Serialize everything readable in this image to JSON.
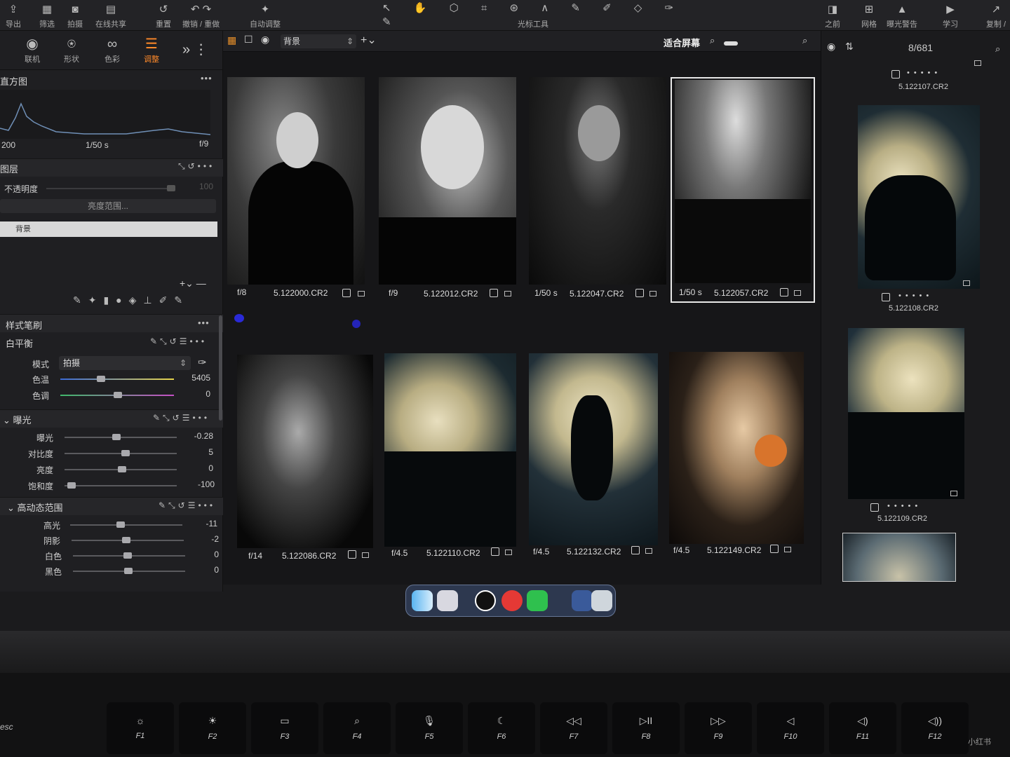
{
  "toolbar": {
    "left_items": [
      "导出",
      "筛选",
      "拍摄",
      "在线共享",
      "重置",
      "撤销 / 重做",
      "自动调整"
    ],
    "center_label": "光标工具",
    "right_items": [
      "之前",
      "网格",
      "曝光警告",
      "学习",
      "复制 / 应"
    ]
  },
  "tabs": [
    {
      "label": "联机",
      "icon": "camera-icon"
    },
    {
      "label": "形状",
      "icon": "shape-icon"
    },
    {
      "label": "色彩",
      "icon": "color-icon"
    },
    {
      "label": "调整",
      "icon": "adjust-icon",
      "active": true
    }
  ],
  "histogram": {
    "title": "直方图",
    "iso": "200",
    "shutter": "1/50 s",
    "aperture": "f/9"
  },
  "layers": {
    "title": "图层",
    "opacity_label": "不透明度",
    "opacity_value": "100",
    "range_button": "亮度范围...",
    "layer_name": "背景"
  },
  "style_brush": {
    "title": "样式笔刷"
  },
  "white_balance": {
    "title": "白平衡",
    "mode_label": "模式",
    "mode_value": "拍摄",
    "rows": [
      {
        "label": "色温",
        "value": "5405",
        "pos": 0.36
      },
      {
        "label": "色调",
        "value": "0",
        "pos": 0.5
      }
    ]
  },
  "exposure": {
    "title": "曝光",
    "rows": [
      {
        "label": "曝光",
        "value": "-0.28",
        "pos": 0.45
      },
      {
        "label": "对比度",
        "value": "5",
        "pos": 0.52
      },
      {
        "label": "亮度",
        "value": "0",
        "pos": 0.5
      },
      {
        "label": "饱和度",
        "value": "-100",
        "pos": 0.0
      }
    ]
  },
  "hdr": {
    "title": "高动态范围",
    "rows": [
      {
        "label": "高光",
        "value": "-11",
        "pos": 0.45
      },
      {
        "label": "阴影",
        "value": "-2",
        "pos": 0.49
      },
      {
        "label": "白色",
        "value": "0",
        "pos": 0.5
      },
      {
        "label": "黑色",
        "value": "0",
        "pos": 0.5
      }
    ]
  },
  "viewbar": {
    "layer_select": "背景",
    "fit_label": "适合屏幕",
    "counter": "8/681"
  },
  "grid": [
    {
      "exif": "f/8",
      "name": "5.122000.CR2"
    },
    {
      "exif": "f/9",
      "name": "5.122012.CR2"
    },
    {
      "exif": "1/50 s",
      "name": "5.122047.CR2"
    },
    {
      "exif": "1/50 s",
      "name": "5.122057.CR2",
      "selected": true
    },
    {
      "exif": "f/14",
      "name": "5.122086.CR2"
    },
    {
      "exif": "f/4.5",
      "name": "5.122110.CR2"
    },
    {
      "exif": "f/4.5",
      "name": "5.122132.CR2"
    },
    {
      "exif": "f/4.5",
      "name": "5.122149.CR2"
    }
  ],
  "strip": [
    {
      "name": "5.122107.CR2"
    },
    {
      "name": "5.122108.CR2"
    },
    {
      "name": "5.122109.CR2"
    }
  ],
  "fkeys": [
    {
      "glyph": "☼",
      "key": "F1"
    },
    {
      "glyph": "☀",
      "key": "F2"
    },
    {
      "glyph": "▭",
      "key": "F3"
    },
    {
      "glyph": "⌕",
      "key": "F4"
    },
    {
      "glyph": "🎙",
      "key": "F5"
    },
    {
      "glyph": "☾",
      "key": "F6"
    },
    {
      "glyph": "◁◁",
      "key": "F7"
    },
    {
      "glyph": "▷II",
      "key": "F8"
    },
    {
      "glyph": "▷▷",
      "key": "F9"
    },
    {
      "glyph": "◁",
      "key": "F10"
    },
    {
      "glyph": "◁)",
      "key": "F11"
    },
    {
      "glyph": "◁))",
      "key": "F12"
    }
  ],
  "esc_label": "esc",
  "watermark": "小红书"
}
